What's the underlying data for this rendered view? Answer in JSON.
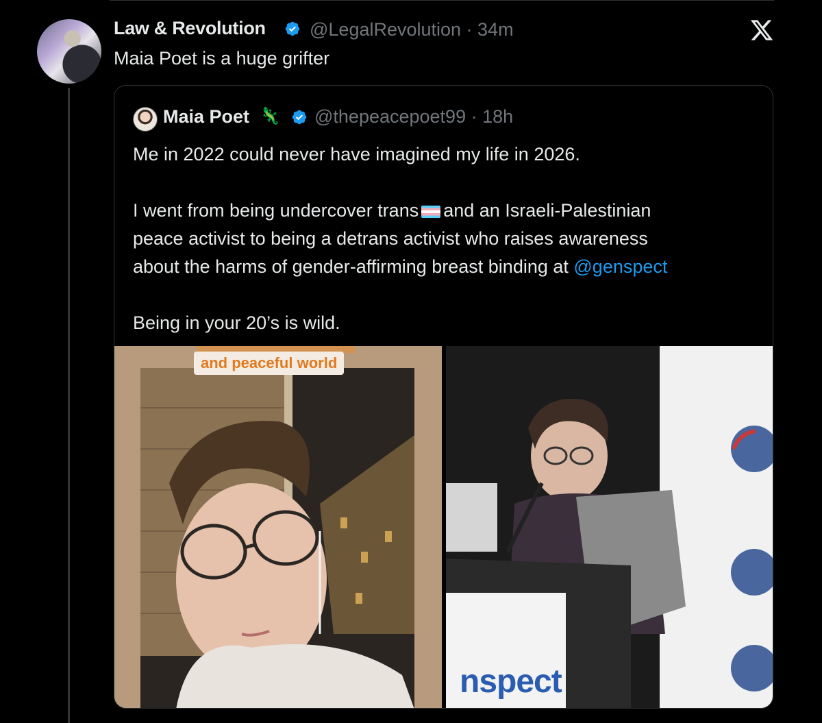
{
  "tweet": {
    "author_name": "Law & Revolution",
    "handle_time": "@LegalRevolution · 34m",
    "text": "Maia Poet is a huge grifter"
  },
  "quote": {
    "author_name": "Maia Poet",
    "author_emoji": "🦎",
    "handle_time": "@thepeacepoet99 · 18h",
    "lines": {
      "l1": "Me in 2022 could never have imagined my life in 2026.",
      "l2a": "I went from being undercover trans",
      "l2b": "and an Israeli-Palestinian",
      "l3": "peace activist to being a detrans activist who raises awareness",
      "l4a": "about the harms of gender-affirming breast binding at ",
      "mention": "@genspect",
      "l5": "Being in your 20’s is wild."
    },
    "media": {
      "left_caption": "and peaceful world",
      "right_sign": "nspect"
    }
  },
  "colors": {
    "background": "#000000",
    "text": "#e7e9ea",
    "secondary": "#71767b",
    "link": "#1d9bf0",
    "verified": "#1d9bf0"
  },
  "icons": {
    "verified": "verified-badge-icon",
    "x_logo": "x-logo-icon",
    "trans_flag": "transgender-flag-icon"
  }
}
